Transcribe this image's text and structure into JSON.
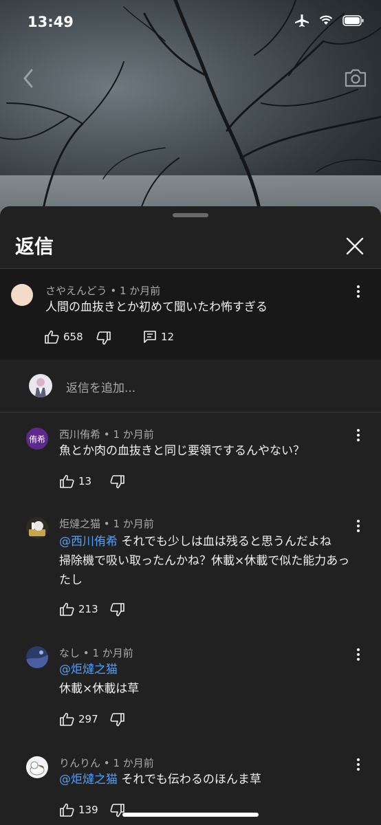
{
  "status": {
    "time": "13:49"
  },
  "sheet": {
    "title": "返信"
  },
  "parent_comment": {
    "author": "さやえんどう",
    "age": "1 か月前",
    "text": "人間の血抜きとか初めて聞いたわ怖すぎる",
    "likes": "658",
    "replies": "12"
  },
  "reply_input": {
    "placeholder": "返信を追加..."
  },
  "replies": [
    {
      "author": "西川侑希",
      "age": "1 か月前",
      "avatar_text": "侑希",
      "avatar_color": "#5b2a8c",
      "mention": "",
      "lines": [
        "魚とか肉の血抜きと同じ要領でするんやない？"
      ],
      "likes": "13"
    },
    {
      "author": "炬燵之猫",
      "age": "1 か月前",
      "avatar_text": "",
      "mention": "@西川侑希",
      "lines": [
        "それでも少しは血は残ると思うんだよね",
        "掃除機で吸い取ったんかね？休載×休載で似た能力あっ",
        "たし"
      ],
      "likes": "213"
    },
    {
      "author": "なし",
      "age": "1 か月前",
      "avatar_text": "",
      "mention": "@炬燵之猫",
      "lines": [
        "",
        "休載×休載は草"
      ],
      "likes": "297"
    },
    {
      "author": "りんりん",
      "age": "1 か月前",
      "avatar_text": "",
      "mention": "@炬燵之猫",
      "lines": [
        "それでも伝わるのほんま草"
      ],
      "likes": "139"
    }
  ],
  "separator": "•",
  "colors": {
    "background": "#212121",
    "parent_bg": "#181818",
    "mention": "#4ea0ff",
    "muted": "#aaaaaa"
  }
}
